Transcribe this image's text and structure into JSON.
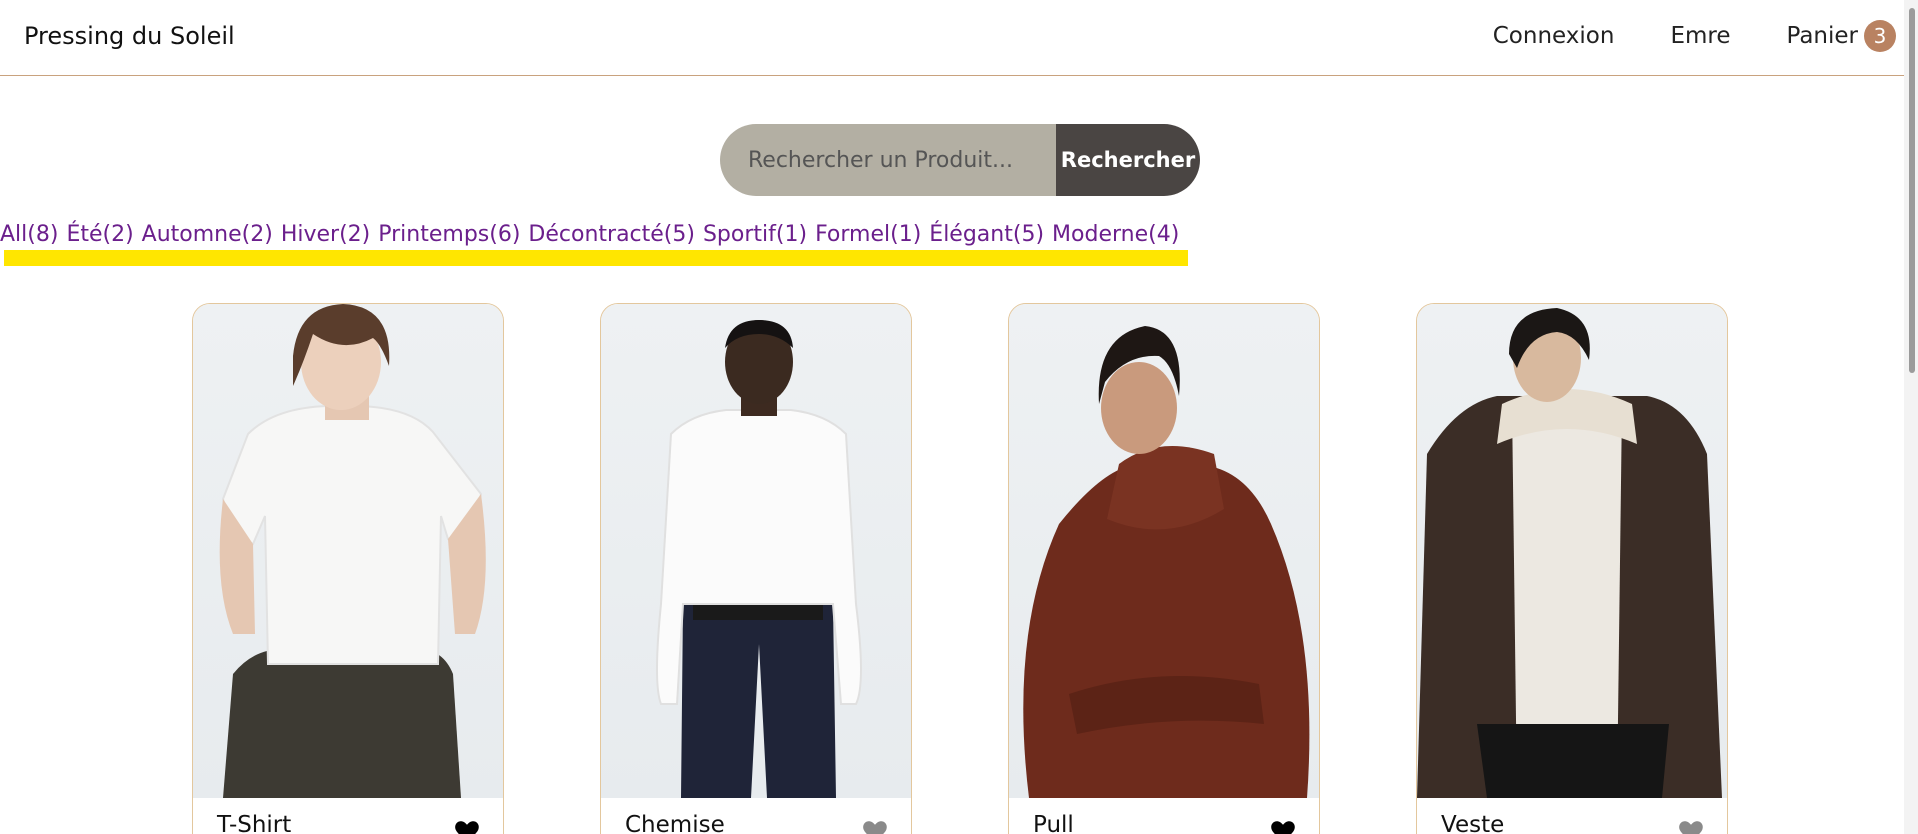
{
  "header": {
    "brand": "Pressing du Soleil",
    "nav": {
      "login": "Connexion",
      "user": "Emre",
      "cart_label": "Panier",
      "cart_count": "3"
    }
  },
  "search": {
    "placeholder": "Rechercher un Produit...",
    "button_label": "Rechercher"
  },
  "filters": [
    "All(8)",
    "Été(2)",
    "Automne(2)",
    "Hiver(2)",
    "Printemps(6)",
    "Décontracté(5)",
    "Sportif(1)",
    "Formel(1)",
    "Élégant(5)",
    "Moderne(4)"
  ],
  "products": [
    {
      "name": "T-Shirt",
      "favorite": true
    },
    {
      "name": "Chemise",
      "favorite": false
    },
    {
      "name": "Pull",
      "favorite": true
    },
    {
      "name": "Veste",
      "favorite": false
    }
  ],
  "colors": {
    "accent_border": "#c9a27e",
    "badge": "#b98261",
    "filter_text": "#6b1f8c",
    "highlight": "#ffe600",
    "search_bg": "#b3afa3",
    "search_button": "#4a4543",
    "heart_favorite": "#000000",
    "heart_default": "#8a8a8a"
  }
}
